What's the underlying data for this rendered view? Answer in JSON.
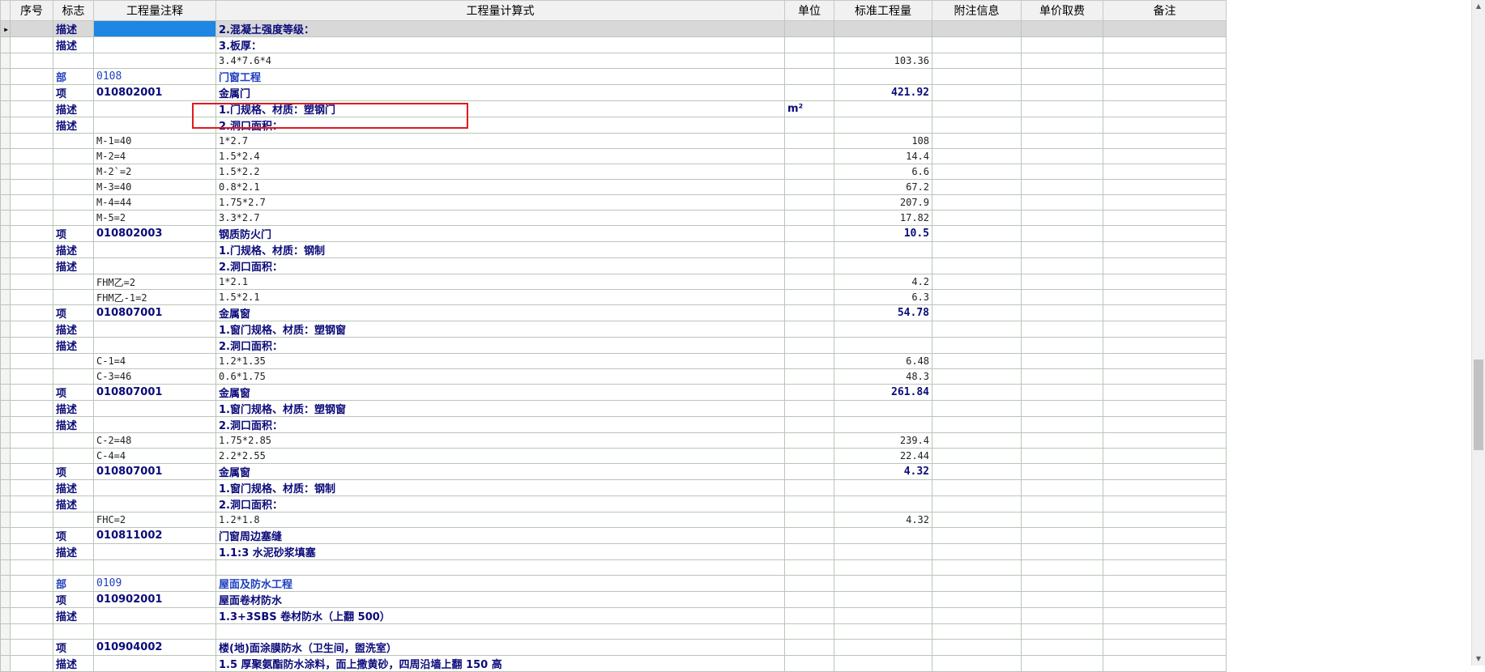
{
  "columns": [
    "序号",
    "标志",
    "工程量注释",
    "工程量计算式",
    "单位",
    "标准工程量",
    "附注信息",
    "单价取费",
    "备注"
  ],
  "rows": [
    {
      "kind": "bold first",
      "ind": "▸",
      "tag": "描述",
      "note": "",
      "expr": "2.混凝土强度等级：",
      "unit": "",
      "qty": ""
    },
    {
      "kind": "bold",
      "ind": "",
      "tag": "描述",
      "note": "",
      "expr": "3.板厚：",
      "unit": "",
      "qty": ""
    },
    {
      "kind": "sub",
      "ind": "",
      "tag": "",
      "note": "",
      "expr": "3.4*7.6*4",
      "unit": "",
      "qty": "103.36"
    },
    {
      "kind": "part",
      "ind": "",
      "tag": "部",
      "note": "0108",
      "expr": "门窗工程",
      "unit": "",
      "qty": ""
    },
    {
      "kind": "bold",
      "ind": "",
      "tag": "项",
      "note": "010802001",
      "expr": "金属门",
      "unit": "",
      "qty": "421.92"
    },
    {
      "kind": "bold",
      "ind": "",
      "tag": "描述",
      "note": "",
      "expr": "1.门规格、材质：塑钢门",
      "unit": "m²",
      "qty": ""
    },
    {
      "kind": "bold",
      "ind": "",
      "tag": "描述",
      "note": "",
      "expr": "2.洞口面积：",
      "unit": "",
      "qty": ""
    },
    {
      "kind": "sub",
      "ind": "",
      "tag": "",
      "note": "M-1=40",
      "expr": "1*2.7",
      "unit": "",
      "qty": "108"
    },
    {
      "kind": "sub",
      "ind": "",
      "tag": "",
      "note": "M-2=4",
      "expr": "1.5*2.4",
      "unit": "",
      "qty": "14.4"
    },
    {
      "kind": "sub",
      "ind": "",
      "tag": "",
      "note": "M-2`=2",
      "expr": "1.5*2.2",
      "unit": "",
      "qty": "6.6"
    },
    {
      "kind": "sub",
      "ind": "",
      "tag": "",
      "note": "M-3=40",
      "expr": "0.8*2.1",
      "unit": "",
      "qty": "67.2"
    },
    {
      "kind": "sub",
      "ind": "",
      "tag": "",
      "note": "M-4=44",
      "expr": "1.75*2.7",
      "unit": "",
      "qty": "207.9"
    },
    {
      "kind": "sub",
      "ind": "",
      "tag": "",
      "note": "M-5=2",
      "expr": "3.3*2.7",
      "unit": "",
      "qty": "17.82"
    },
    {
      "kind": "bold",
      "ind": "",
      "tag": "项",
      "note": "010802003",
      "expr": "钢质防火门",
      "unit": "",
      "qty": "10.5"
    },
    {
      "kind": "bold",
      "ind": "",
      "tag": "描述",
      "note": "",
      "expr": "1.门规格、材质：钢制",
      "unit": "",
      "qty": ""
    },
    {
      "kind": "bold",
      "ind": "",
      "tag": "描述",
      "note": "",
      "expr": "2.洞口面积：",
      "unit": "",
      "qty": ""
    },
    {
      "kind": "sub",
      "ind": "",
      "tag": "",
      "note": "FHM乙=2",
      "expr": "1*2.1",
      "unit": "",
      "qty": "4.2"
    },
    {
      "kind": "sub",
      "ind": "",
      "tag": "",
      "note": "FHM乙-1=2",
      "expr": "1.5*2.1",
      "unit": "",
      "qty": "6.3"
    },
    {
      "kind": "bold",
      "ind": "",
      "tag": "项",
      "note": "010807001",
      "expr": "金属窗",
      "unit": "",
      "qty": "54.78"
    },
    {
      "kind": "bold",
      "ind": "",
      "tag": "描述",
      "note": "",
      "expr": "1.窗门规格、材质：塑钢窗",
      "unit": "",
      "qty": ""
    },
    {
      "kind": "bold",
      "ind": "",
      "tag": "描述",
      "note": "",
      "expr": "2.洞口面积：",
      "unit": "",
      "qty": ""
    },
    {
      "kind": "sub",
      "ind": "",
      "tag": "",
      "note": "C-1=4",
      "expr": "1.2*1.35",
      "unit": "",
      "qty": "6.48"
    },
    {
      "kind": "sub",
      "ind": "",
      "tag": "",
      "note": "C-3=46",
      "expr": "0.6*1.75",
      "unit": "",
      "qty": "48.3"
    },
    {
      "kind": "bold",
      "ind": "",
      "tag": "项",
      "note": "010807001",
      "expr": "金属窗",
      "unit": "",
      "qty": "261.84"
    },
    {
      "kind": "bold",
      "ind": "",
      "tag": "描述",
      "note": "",
      "expr": "1.窗门规格、材质：塑钢窗",
      "unit": "",
      "qty": ""
    },
    {
      "kind": "bold",
      "ind": "",
      "tag": "描述",
      "note": "",
      "expr": "2.洞口面积：",
      "unit": "",
      "qty": ""
    },
    {
      "kind": "sub",
      "ind": "",
      "tag": "",
      "note": "C-2=48",
      "expr": "1.75*2.85",
      "unit": "",
      "qty": "239.4"
    },
    {
      "kind": "sub",
      "ind": "",
      "tag": "",
      "note": "C-4=4",
      "expr": "2.2*2.55",
      "unit": "",
      "qty": "22.44"
    },
    {
      "kind": "bold",
      "ind": "",
      "tag": "项",
      "note": "010807001",
      "expr": "金属窗",
      "unit": "",
      "qty": "4.32"
    },
    {
      "kind": "bold",
      "ind": "",
      "tag": "描述",
      "note": "",
      "expr": "1.窗门规格、材质：钢制",
      "unit": "",
      "qty": ""
    },
    {
      "kind": "bold",
      "ind": "",
      "tag": "描述",
      "note": "",
      "expr": "2.洞口面积：",
      "unit": "",
      "qty": ""
    },
    {
      "kind": "sub",
      "ind": "",
      "tag": "",
      "note": "FHC=2",
      "expr": "1.2*1.8",
      "unit": "",
      "qty": "4.32"
    },
    {
      "kind": "bold",
      "ind": "",
      "tag": "项",
      "note": "010811002",
      "expr": "门窗周边塞缝",
      "unit": "",
      "qty": ""
    },
    {
      "kind": "bold",
      "ind": "",
      "tag": "描述",
      "note": "",
      "expr": "1.1:3 水泥砂浆填塞",
      "unit": "",
      "qty": ""
    },
    {
      "kind": "sub",
      "ind": "",
      "tag": "",
      "note": "",
      "expr": "",
      "unit": "",
      "qty": ""
    },
    {
      "kind": "part",
      "ind": "",
      "tag": "部",
      "note": "0109",
      "expr": "屋面及防水工程",
      "unit": "",
      "qty": ""
    },
    {
      "kind": "bold",
      "ind": "",
      "tag": "项",
      "note": "010902001",
      "expr": "屋面卷材防水",
      "unit": "",
      "qty": ""
    },
    {
      "kind": "bold",
      "ind": "",
      "tag": "描述",
      "note": "",
      "expr": "1.3+3SBS 卷材防水（上翻 500）",
      "unit": "",
      "qty": ""
    },
    {
      "kind": "sub",
      "ind": "",
      "tag": "",
      "note": "",
      "expr": "",
      "unit": "",
      "qty": ""
    },
    {
      "kind": "bold",
      "ind": "",
      "tag": "项",
      "note": "010904002",
      "expr": "楼(地)面涂膜防水（卫生间，盥洗室）",
      "unit": "",
      "qty": ""
    },
    {
      "kind": "bold",
      "ind": "",
      "tag": "描述",
      "note": "",
      "expr": "1.5 厚聚氨酯防水涂料，面上撒黄砂，四周沿墙上翻 150 高",
      "unit": "",
      "qty": ""
    }
  ],
  "scrollbar": {
    "up": "▲",
    "down": "▼"
  },
  "colors": {
    "highlight": "#e0191f",
    "selected_cell": "#1f86e3",
    "text_blue": "#0b0b7a",
    "part_blue": "#1f3fbf"
  }
}
